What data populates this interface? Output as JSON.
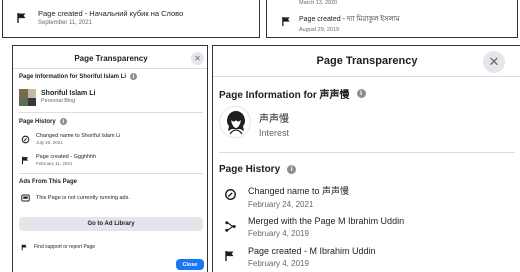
{
  "top_left": {
    "event_title": "Page created - Начальний кубик на Слово",
    "event_date": "September 11, 2021"
  },
  "top_right": {
    "prev_date": "March 13, 2020",
    "event_title": "Page created - দ্যা মিরাকুল ইসলাম",
    "event_date": "August 29, 2019"
  },
  "left_panel": {
    "title": "Page Transparency",
    "info_heading": "Page Information for Shoriful Islam Li",
    "page_name": "Shoriful Islam Li",
    "page_category": "Personal Blog",
    "history_heading": "Page History",
    "history": [
      {
        "icon": "name-change-icon",
        "title": "Changed name to Shoriful Islam Li",
        "date": "July 20, 2021"
      },
      {
        "icon": "flag-icon",
        "title": "Page created - Ggghhhh",
        "date": "February 11, 2021"
      }
    ],
    "ads_heading": "Ads From This Page",
    "ads_status": "This Page is not currently running ads.",
    "ad_library_button": "Go to Ad Library",
    "support_link": "Find support or report Page",
    "close_button": "Close"
  },
  "right_panel": {
    "title": "Page Transparency",
    "info_heading": "Page Information for 声声慢",
    "page_name": "声声慢",
    "page_category": "Interest",
    "history_heading": "Page History",
    "history": [
      {
        "icon": "name-change-icon",
        "title": "Changed name to 声声慢",
        "date": "February 24, 2021"
      },
      {
        "icon": "merge-icon",
        "title": "Merged with the Page M Ibrahim Uddin",
        "date": "February 4, 2019"
      },
      {
        "icon": "flag-icon",
        "title": "Page created - M Ibrahim Uddin",
        "date": "February 4, 2019"
      }
    ]
  },
  "colors": {
    "accent": "#1877f2",
    "secondary_text": "#65676b",
    "button_gray": "#e4e6eb"
  }
}
